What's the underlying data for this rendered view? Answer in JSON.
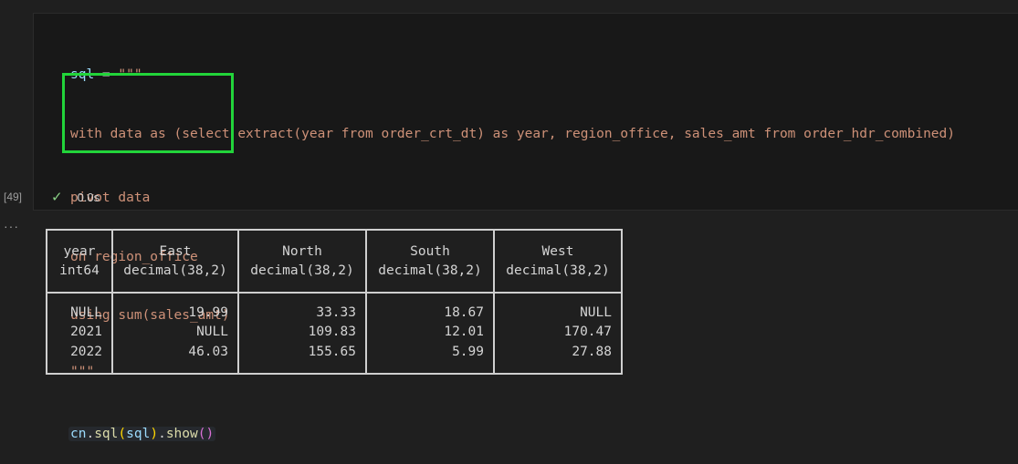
{
  "cell": {
    "execution_count": "[49]",
    "status_time": "0.0s",
    "code": {
      "line1_var": "sql",
      "line1_op": " = ",
      "line1_str": "\"\"\"",
      "line2": "with data as (select extract(year from order_crt_dt) as year, region_office, sales_amt from order_hdr_combined)",
      "line3": "pivot data",
      "line4": "on region_office",
      "line5": "using sum(sales_amt)",
      "line6": "\"\"\"",
      "call_obj": "cn",
      "call_dot1": ".",
      "call_fn1": "sql",
      "call_arg": "sql",
      "call_dot2": ".",
      "call_fn2": "show",
      "call_open": "(",
      "call_close": ")",
      "call_paren_y": "()"
    }
  },
  "output": {
    "more_label": "···",
    "headers": [
      {
        "name": "year",
        "type": "int64"
      },
      {
        "name": "East",
        "type": "decimal(38,2)"
      },
      {
        "name": "North",
        "type": "decimal(38,2)"
      },
      {
        "name": "South",
        "type": "decimal(38,2)"
      },
      {
        "name": "West",
        "type": "decimal(38,2)"
      }
    ],
    "rows": [
      [
        "NULL",
        "19.99",
        "33.33",
        "18.67",
        "NULL"
      ],
      [
        "2021",
        "NULL",
        "109.83",
        "12.01",
        "170.47"
      ],
      [
        "2022",
        "46.03",
        "155.65",
        "5.99",
        "27.88"
      ]
    ]
  },
  "colors": {
    "highlight_box": "#22d43a",
    "background": "#1f1f1f",
    "string": "#ce9178",
    "variable": "#9cdcfe"
  }
}
